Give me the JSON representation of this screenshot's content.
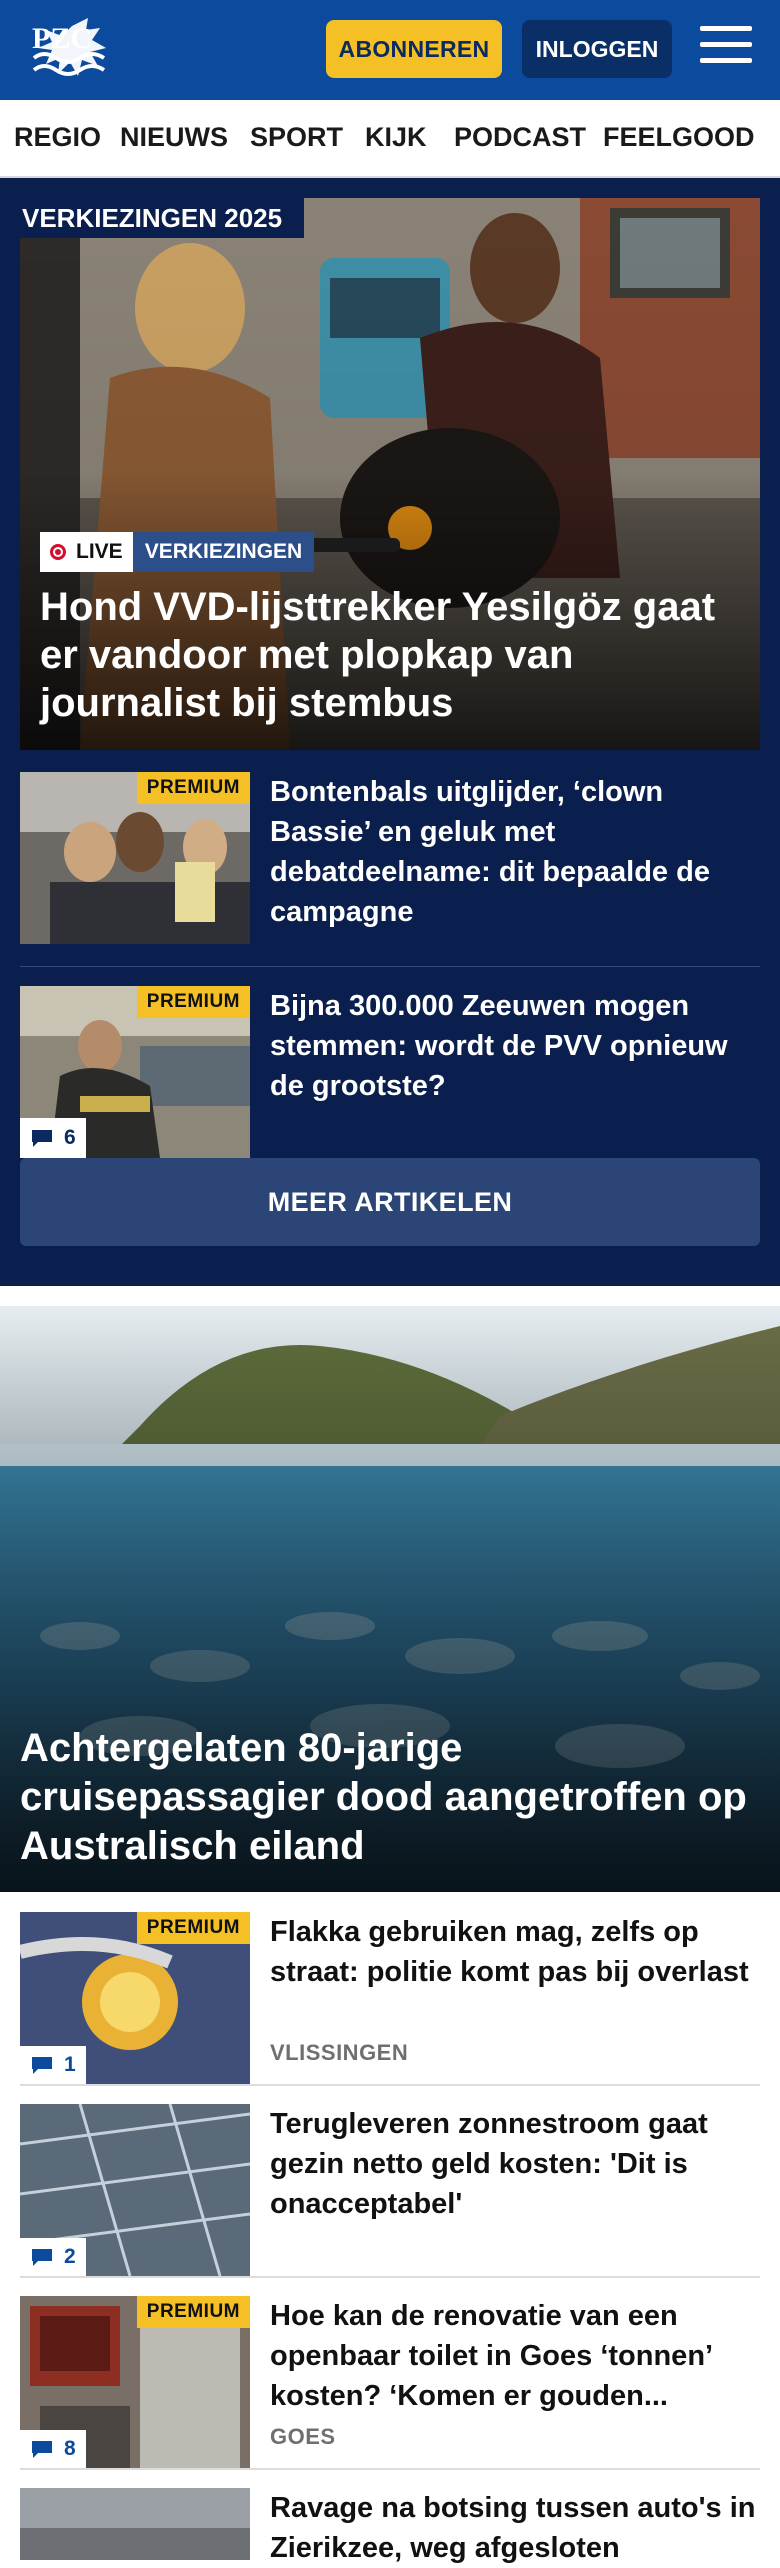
{
  "header": {
    "logo_text": "PZC",
    "subscribe_label": "ABONNEREN",
    "login_label": "INLOGGEN"
  },
  "nav": {
    "items": [
      "REGIO",
      "NIEUWS",
      "SPORT",
      "KIJK",
      "PODCAST",
      "FEELGOOD"
    ]
  },
  "elections": {
    "section_label": "VERKIEZINGEN 2025",
    "hero": {
      "live_label": "LIVE",
      "topic_label": "VERKIEZINGEN",
      "title": "Hond VVD-lijsttrekker Yesilgöz gaat er vandoor met plopkap van journalist bij stembus"
    },
    "teasers": [
      {
        "badge": "PREMIUM",
        "title": "Bontenbals uitglijder, ‘clown Bassie’ en geluk met debatdeelname: dit bepaalde de campagne"
      },
      {
        "badge": "PREMIUM",
        "title": "Bijna 300.000 Zeeuwen mogen stemmen: wordt de PVV opnieuw de grootste?",
        "comments": "6"
      }
    ],
    "more_label": "MEER ARTIKELEN"
  },
  "big_story": {
    "title": "Achtergelaten 80-jarige cruisepassagier dood aangetroffen op Australisch eiland"
  },
  "list": [
    {
      "badge": "PREMIUM",
      "title": "Flakka gebruiken mag, zelfs op straat: politie komt pas bij overlast",
      "region": "VLISSINGEN",
      "comments": "1"
    },
    {
      "title": "Terugleveren zonnestroom gaat gezin netto geld kosten: 'Dit is onacceptabel'",
      "comments": "2"
    },
    {
      "badge": "PREMIUM",
      "title": "Hoe kan de renovatie van een openbaar toilet in Goes ‘tonnen’ kosten? ‘Komen er gouden...",
      "region": "GOES",
      "comments": "8"
    },
    {
      "title": "Ravage na botsing tussen auto's in Zierikzee, weg afgesloten"
    }
  ],
  "colors": {
    "brand_blue": "#0b4a9c",
    "elections_bg": "#0b1f4e",
    "premium_yellow": "#f4c025"
  }
}
